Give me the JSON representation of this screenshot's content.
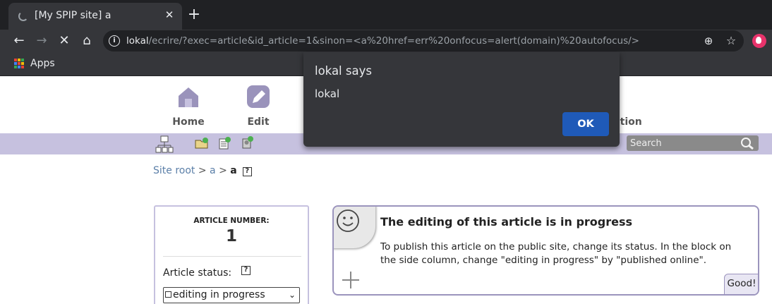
{
  "browser": {
    "tab_title": "[My SPIP site] a",
    "url_host": "lokal",
    "url_rest": "/ecrire/?exec=article&id_article=1&sinon=<a%20href=err%20onfocus=alert(domain)%20autofocus/>",
    "bookmarks": {
      "apps_label": "Apps"
    }
  },
  "dialog": {
    "title": "lokal says",
    "message": "lokal",
    "ok_label": "OK"
  },
  "main_nav": {
    "home_label": "Home",
    "edit_label": "Edit",
    "admin_label": "ration"
  },
  "search": {
    "placeholder": "Search"
  },
  "breadcrumb": {
    "root": "Site root",
    "sep1": " > ",
    "section": "a",
    "sep2": " > ",
    "current": "a"
  },
  "article": {
    "number_label": "ARTICLE NUMBER:",
    "number": "1",
    "status_label": "Article status:",
    "status_value": "editing in progress"
  },
  "notice": {
    "title": "The editing of this article is in progress",
    "text": "To publish this article on the public site, change its status. In the block on the side column, change \"editing in progress\" by \"published online\".",
    "good_label": "Good!"
  },
  "colors": {
    "subbar": "#c6c1df",
    "notice_border": "#9b94bd",
    "ok_button": "#1f5ab8"
  }
}
